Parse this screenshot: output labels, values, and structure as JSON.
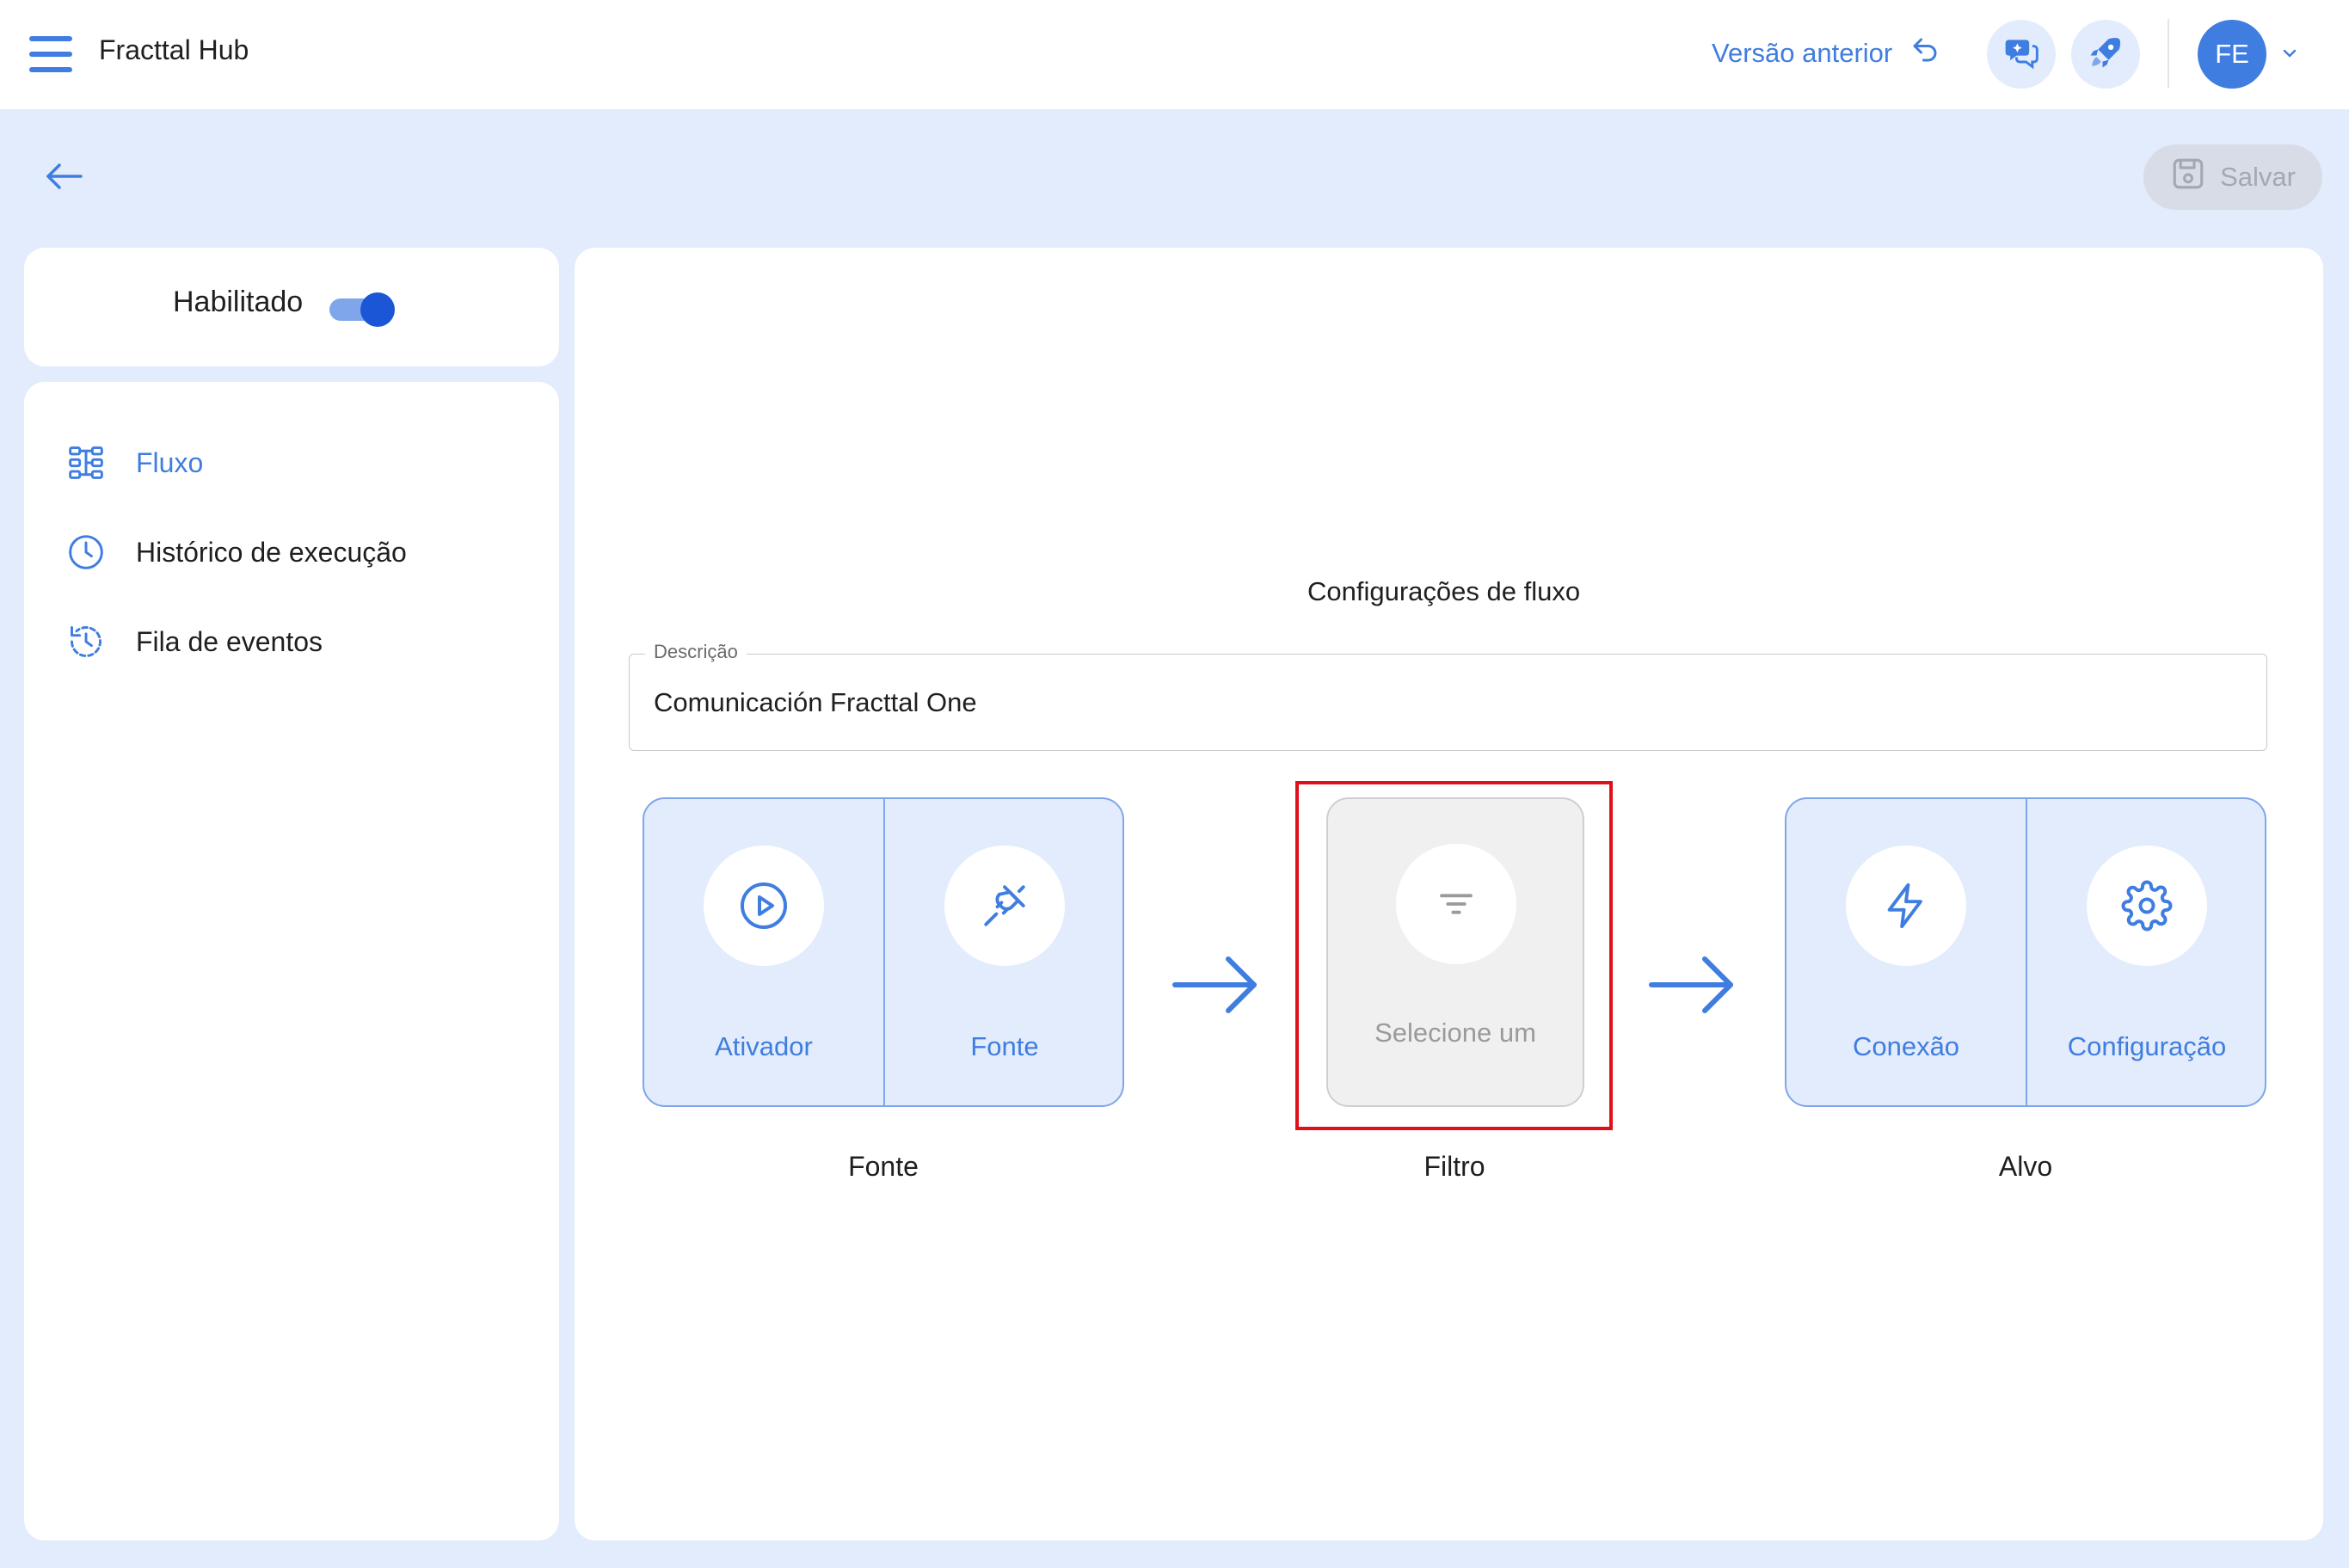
{
  "header": {
    "app_title": "Fracttal Hub",
    "prev_version_label": "Versão anterior",
    "user_initials": "FE",
    "icons": [
      "menu-icon",
      "undo-icon",
      "chat-ai-icon",
      "rocket-icon",
      "chevron-down-icon"
    ]
  },
  "toolbar": {
    "save_label": "Salvar"
  },
  "sidebar": {
    "enabled_label": "Habilitado",
    "enabled": true,
    "items": [
      {
        "label": "Fluxo",
        "icon": "flow-icon",
        "active": true
      },
      {
        "label": "Histórico de execução",
        "icon": "clock-icon",
        "active": false
      },
      {
        "label": "Fila de eventos",
        "icon": "history-icon",
        "active": false
      }
    ]
  },
  "main": {
    "section_title": "Configurações de fluxo",
    "description_legend": "Descrição",
    "description_value": "Comunicación Fracttal One",
    "source": {
      "caption": "Fonte",
      "nodes": [
        {
          "label": "Ativador",
          "icon": "play-icon"
        },
        {
          "label": "Fonte",
          "icon": "plug-icon"
        }
      ]
    },
    "filter": {
      "caption": "Filtro",
      "placeholder": "Selecione um",
      "icon": "filter-icon"
    },
    "target": {
      "caption": "Alvo",
      "nodes": [
        {
          "label": "Conexão",
          "icon": "bolt-icon"
        },
        {
          "label": "Configuração",
          "icon": "gear-icon"
        }
      ]
    }
  },
  "colors": {
    "accent": "#3f7de0",
    "background": "#e3ecfc",
    "highlight": "#e0101a"
  }
}
